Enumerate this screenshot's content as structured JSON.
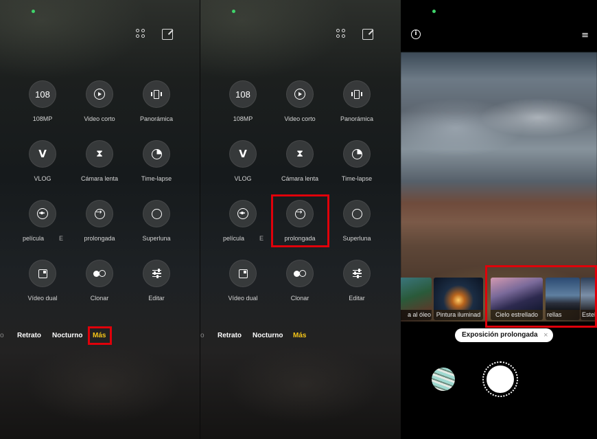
{
  "panel1": {
    "modes": [
      {
        "label": "108MP",
        "icon": "108"
      },
      {
        "label": "Video corto",
        "icon": "play-icon"
      },
      {
        "label": "Panorámica",
        "icon": "panorama-icon"
      },
      {
        "label": "VLOG",
        "icon": "vlog-icon"
      },
      {
        "label": "Cámara lenta",
        "icon": "hourglass-icon"
      },
      {
        "label": "Time-lapse",
        "icon": "timer-icon"
      },
      {
        "label": "película",
        "icon": "film-icon"
      },
      {
        "label": "prolongada",
        "icon": "long-exposure-icon"
      },
      {
        "label": "Superluna",
        "icon": "moon-icon"
      },
      {
        "label": "Vídeo dual",
        "icon": "dual-video-icon"
      },
      {
        "label": "Clonar",
        "icon": "clone-icon"
      },
      {
        "label": "Editar",
        "icon": "edit-sliders-icon"
      }
    ],
    "film_suffix": "E",
    "mode_bar": {
      "partial": "o",
      "retrato": "Retrato",
      "nocturno": "Nocturno",
      "mas": "Más"
    }
  },
  "panel2": {
    "modes": [
      {
        "label": "108MP",
        "icon": "108"
      },
      {
        "label": "Video corto",
        "icon": "play-icon"
      },
      {
        "label": "Panorámica",
        "icon": "panorama-icon"
      },
      {
        "label": "VLOG",
        "icon": "vlog-icon"
      },
      {
        "label": "Cámara lenta",
        "icon": "hourglass-icon"
      },
      {
        "label": "Time-lapse",
        "icon": "timer-icon"
      },
      {
        "label": "película",
        "icon": "film-icon"
      },
      {
        "label": "prolongada",
        "icon": "long-exposure-icon"
      },
      {
        "label": "Superluna",
        "icon": "moon-icon"
      },
      {
        "label": "Vídeo dual",
        "icon": "dual-video-icon"
      },
      {
        "label": "Clonar",
        "icon": "clone-icon"
      },
      {
        "label": "Editar",
        "icon": "edit-sliders-icon"
      }
    ],
    "film_suffix": "E",
    "mode_bar": {
      "partial": "o",
      "retrato": "Retrato",
      "nocturno": "Nocturno",
      "mas": "Más"
    }
  },
  "panel3": {
    "info_glyph": "i",
    "menu_glyph": "≡",
    "filters": [
      "a al óleo",
      "Pintura iluminad",
      "Cielo estrellado",
      "rellas",
      "Estel"
    ],
    "selected_filter": "Cielo estrellado",
    "chip_label": "Exposición prolongada",
    "chip_close": "×"
  },
  "colors": {
    "accent": "#f5c518",
    "highlight": "#e0000a",
    "status": "#3fd46b"
  }
}
